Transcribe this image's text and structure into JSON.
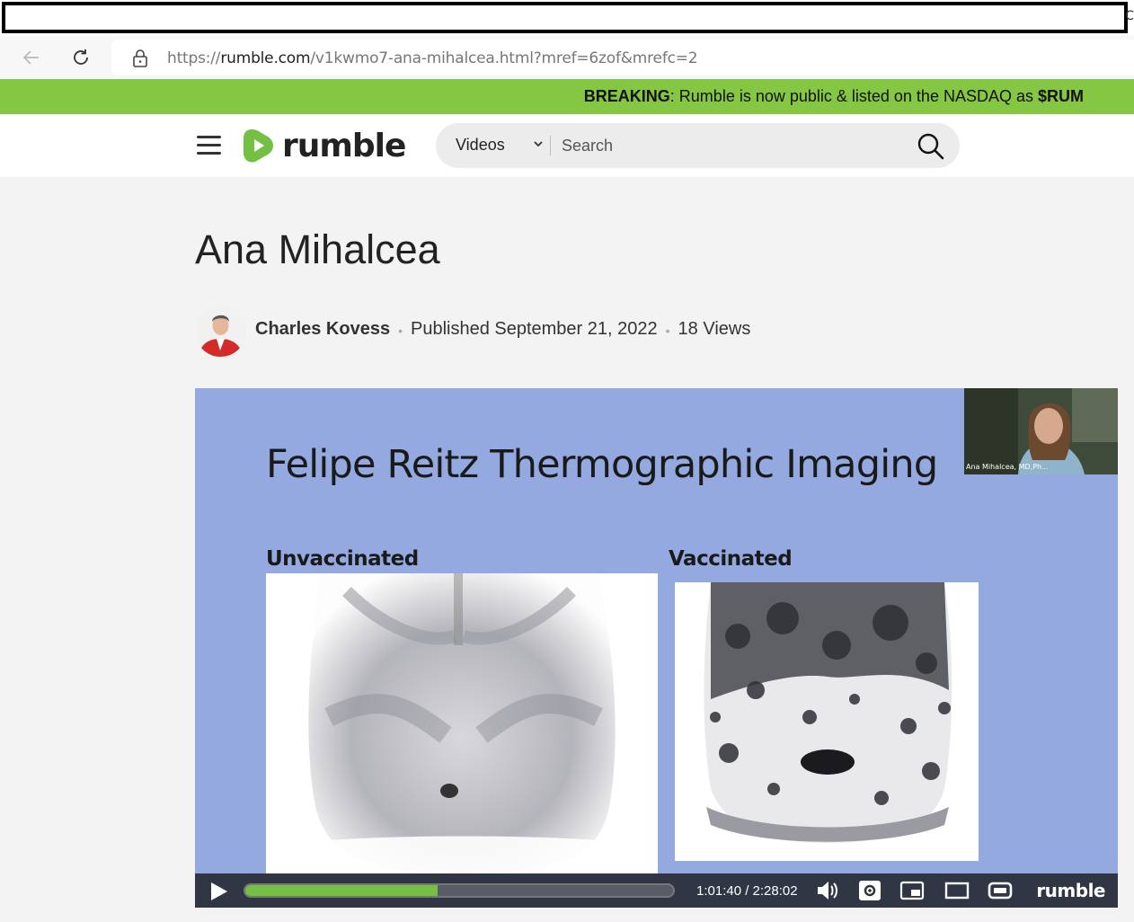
{
  "browser": {
    "edge_char": "C",
    "url_scheme": "https://",
    "url_host": "rumble.com",
    "url_path": "/v1kwmo7-ana-mihalcea.html?mref=6zof&mrefc=2",
    "icons": [
      "back-arrow-icon",
      "refresh-icon",
      "lock-icon"
    ]
  },
  "banner": {
    "label": "BREAKING",
    "text": ": Rumble is now public & listed on the NASDAQ as ",
    "ticker": "$RUM",
    "color": "#85c742"
  },
  "header": {
    "brand": "rumble",
    "search_category": "Videos",
    "search_placeholder": "Search",
    "icons": [
      "menu-icon",
      "rumble-logo-icon",
      "chevron-down-icon",
      "search-icon"
    ]
  },
  "video_page": {
    "title": "Ana Mihalcea",
    "author": "Charles Kovess",
    "published": "Published September 21, 2022",
    "views": "18 Views"
  },
  "video": {
    "slide_title": "Felipe Reitz Thermographic Imaging",
    "left_caption": "Unvaccinated",
    "right_caption": "Vaccinated",
    "webcam_label": "Ana Mihalcea, MD,Ph...",
    "time": "1:01:40 / 2:28:02",
    "progress_fraction": 0.45,
    "brand": "rumble",
    "background_color": "#93a9df",
    "icons": [
      "play-icon",
      "volume-icon",
      "settings-icon",
      "pip-icon",
      "theater-icon",
      "fullscreen-icon"
    ]
  }
}
